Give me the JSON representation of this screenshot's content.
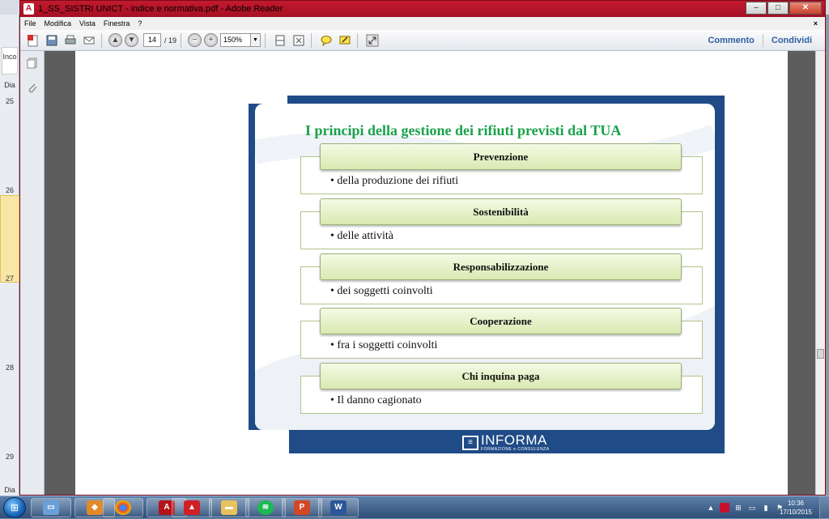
{
  "window": {
    "title": "1_SS_SISTRI UNICT - indice e normativa.pdf - Adobe Reader",
    "app_icon": "pdf-icon",
    "buttons": [
      "minimize",
      "maximize",
      "close"
    ]
  },
  "menubar": {
    "items": [
      "File",
      "Modifica",
      "Vista",
      "Finestra",
      "?"
    ],
    "close_glyph": "×"
  },
  "toolbar": {
    "current_page": "14",
    "total_pages": "/ 19",
    "zoom": "150%",
    "comment_label": "Commento",
    "share_label": "Condividi"
  },
  "background_app": {
    "ruler_numbers": [
      "25",
      "26",
      "27",
      "28",
      "29"
    ],
    "side_labels": [
      "Inco",
      "Dia",
      "Dia"
    ]
  },
  "slide": {
    "title": "I principi della gestione dei rifiuti previsti dal TUA",
    "items": [
      {
        "heading": "Prevenzione",
        "bullet": "della produzione dei rifiuti"
      },
      {
        "heading": "Sostenibilità",
        "bullet": "delle attività"
      },
      {
        "heading": "Responsabilizzazione",
        "bullet": "dei soggetti coinvolti"
      },
      {
        "heading": "Cooperazione",
        "bullet": "fra i soggetti coinvolti"
      },
      {
        "heading": "Chi inquina paga",
        "bullet": "Il danno cagionato"
      }
    ],
    "bullet_glyph": "•",
    "logo": {
      "name": "INFORMA",
      "tagline": "FORMAZIONE e CONSULENZA"
    }
  },
  "taskbar": {
    "clock_time": "10:36",
    "clock_date": "17/10/2015",
    "pinned": [
      "explorer",
      "app",
      "chrome",
      "acrobat",
      "acrobat-reader",
      "folder",
      "spotify",
      "powerpoint",
      "word"
    ]
  },
  "colors": {
    "slide_title": "#19a24a",
    "slide_frame": "#1f4b87",
    "titlebar": "#c31a2e",
    "toolbar_link": "#2f5fa2"
  }
}
